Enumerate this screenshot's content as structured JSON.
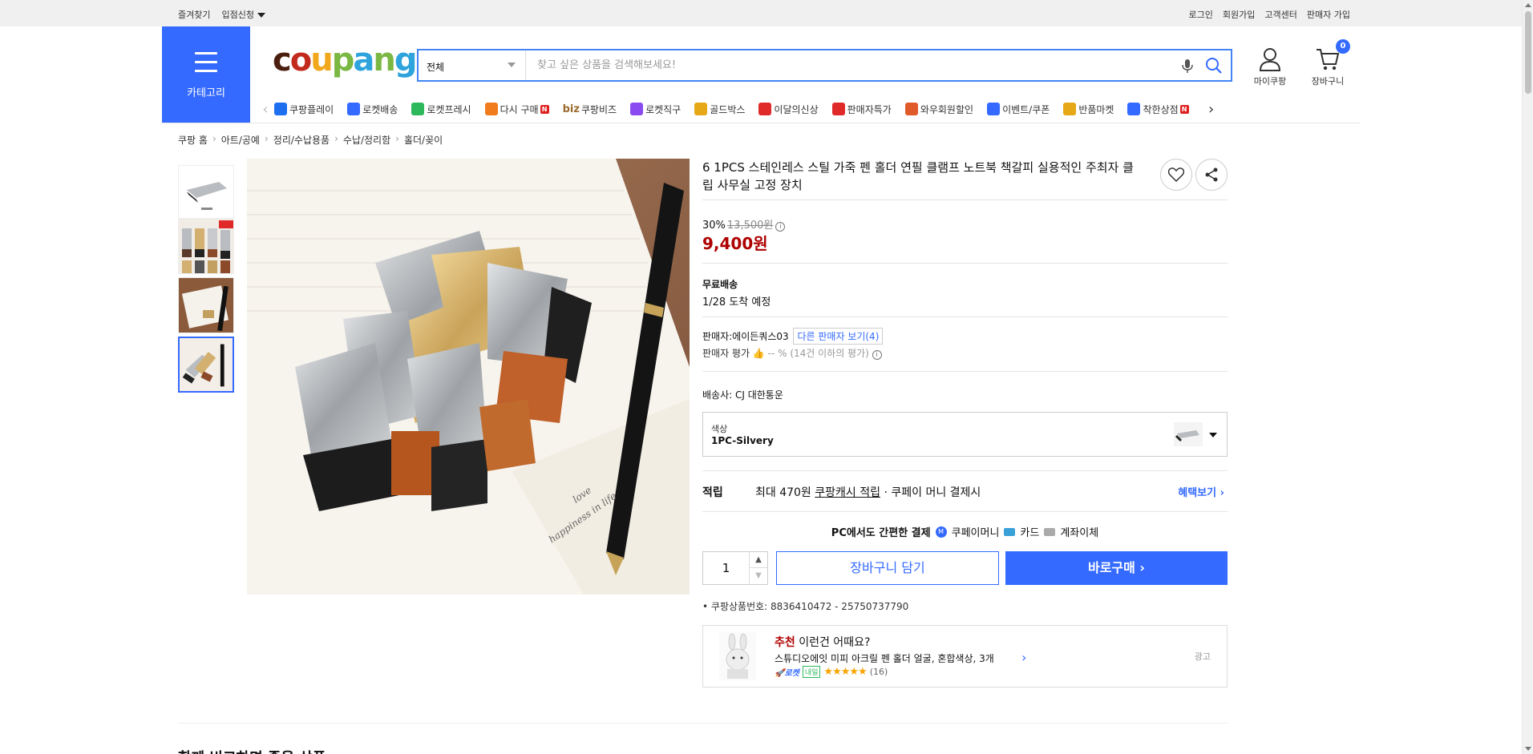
{
  "topbar": {
    "bookmark": "즐겨찾기",
    "partner": "입점신청",
    "login": "로그인",
    "signup": "회원가입",
    "support": "고객센터",
    "seller_signup": "판매자 가입"
  },
  "header": {
    "category_label": "카테고리",
    "logo_letters": [
      "c",
      "o",
      "u",
      "p",
      "a",
      "n",
      "g"
    ],
    "logo_colors": [
      "#4a1f0f",
      "#c22a1e",
      "#f2a81d",
      "#7ab743",
      "#2ea3dc",
      "#7ab743",
      "#2ea3dc"
    ],
    "search_category": "전체",
    "search_placeholder": "찾고 싶은 상품을 검색해보세요!",
    "my_coupang": "마이쿠팡",
    "cart_label": "장바구니",
    "cart_count": "0"
  },
  "nav": {
    "items": [
      {
        "label": "쿠팡플레이",
        "icon": "play-icon",
        "color": "#1e6ff0"
      },
      {
        "label": "로켓배송",
        "icon": "rocket-icon",
        "color": "#346aff"
      },
      {
        "label": "로켓프레시",
        "icon": "rocket-fresh-icon",
        "color": "#2eb85c"
      },
      {
        "label": "다시 구매",
        "icon": "rebuy-icon",
        "color": "#f07c1e",
        "new": true
      },
      {
        "label": "쿠팡비즈",
        "icon": "biz-icon",
        "color": "#9c6b2f",
        "prefix": "biz"
      },
      {
        "label": "로켓직구",
        "icon": "global-icon",
        "color": "#8a4cf0"
      },
      {
        "label": "골드박스",
        "icon": "goldbox-icon",
        "color": "#e6a817"
      },
      {
        "label": "이달의신상",
        "icon": "bag-icon",
        "color": "#e02a2a"
      },
      {
        "label": "판매자특가",
        "icon": "percent-icon",
        "color": "#e02a2a"
      },
      {
        "label": "와우회원할인",
        "icon": "wow-icon",
        "color": "#e05a2a"
      },
      {
        "label": "이벤트/쿠폰",
        "icon": "coupon-icon",
        "color": "#346aff"
      },
      {
        "label": "반품마켓",
        "icon": "return-icon",
        "color": "#e6a817"
      },
      {
        "label": "착한상점",
        "icon": "store-icon",
        "color": "#346aff",
        "new": true
      }
    ],
    "new_label": "N"
  },
  "breadcrumb": [
    "쿠팡 홈",
    "아트/공예",
    "정리/수납용품",
    "수납/정리함",
    "홀더/꽂이"
  ],
  "product": {
    "title": "6 1PCS 스테인레스 스틸 가죽 펜 홀더 연필 클램프 노트북 책갈피 실용적인 주최자 클립 사무실 고정 장치",
    "discount_rate": "30%",
    "original_price": "13,500원",
    "price": "9,400원",
    "shipping_title": "무료배송",
    "arrival": "1/28 도착 예정",
    "seller_label": "판매자:에이든쿼스03",
    "other_sellers": "다른 판매자 보기(4)",
    "seller_rating_label": "판매자 평가",
    "seller_rating_value": "-- % (14건 이하의 평가)",
    "courier": "배송사:  CJ 대한통운",
    "option_key": "색상",
    "option_value": "1PC-Silvery",
    "reward_key": "적립",
    "reward_text_a": "최대 470원 ",
    "reward_text_link": "쿠팡캐시 적립",
    "reward_text_b": " · 쿠페이 머니 결제시",
    "benefit_link": "혜택보기 ›",
    "easypay_title": "PC에서도 간편한 결제",
    "easypay_money": "쿠페이머니",
    "easypay_card": "카드",
    "easypay_bank": "계좌이체",
    "quantity": "1",
    "add_cart": "장바구니 담기",
    "buy_now": "바로구매 ›",
    "product_number": "쿠팡상품번호: 8836410472 - 25750737790"
  },
  "recommend": {
    "tag": "추천",
    "title_rest": " 이런건 어때요?",
    "item": "스튜디오에잇 미피 아크릴 펜 홀더 얼굴, 혼합색상, 3개",
    "rocket": "🚀로켓",
    "tomorrow": "내일",
    "stars": "★★★★★",
    "rating": 5,
    "review_count": "(16)",
    "ad": "광고"
  },
  "bottom": {
    "section_title": "함께 비교하면 좋을 상품"
  }
}
